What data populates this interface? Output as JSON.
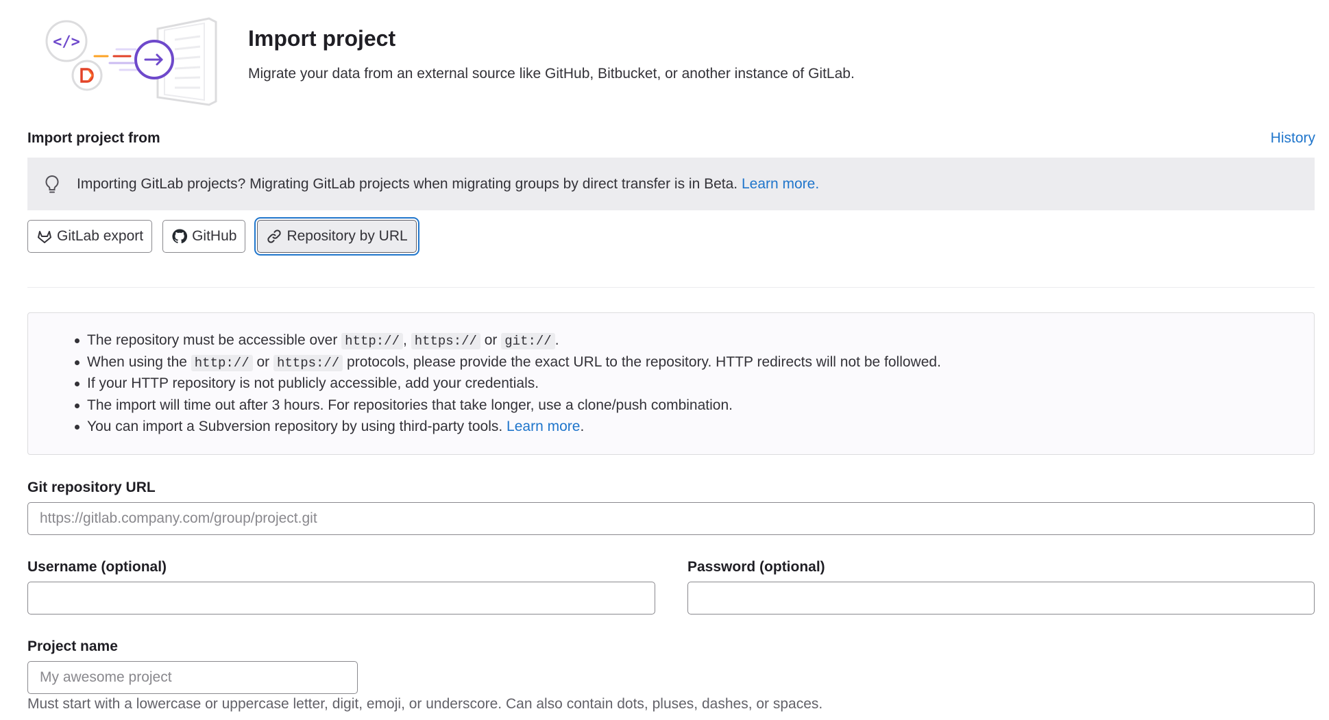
{
  "header": {
    "title": "Import project",
    "subtitle": "Migrate your data from an external source like GitHub, Bitbucket, or another instance of GitLab."
  },
  "import_from": {
    "label": "Import project from",
    "history_link": "History"
  },
  "beta_alert": {
    "icon": "lightbulb-icon",
    "text": "Importing GitLab projects? Migrating GitLab projects when migrating groups by direct transfer is in Beta.",
    "link": "Learn more."
  },
  "sources": [
    {
      "label": "GitLab export",
      "icon": "tanuki-icon",
      "selected": false
    },
    {
      "label": "GitHub",
      "icon": "github-icon",
      "selected": false
    },
    {
      "label": "Repository by URL",
      "icon": "link-icon",
      "selected": true
    }
  ],
  "info": {
    "line1": {
      "text": "The repository must be accessible over",
      "code1": "http://",
      "sep1": ",",
      "code2": "https://",
      "sep2": "or",
      "code3": "git://",
      "end": "."
    },
    "line2": {
      "text": "When using the",
      "code1": "http://",
      "sep1": "or",
      "code2": "https://",
      "rest": "protocols, please provide the exact URL to the repository. HTTP redirects will not be followed."
    },
    "line3": "If your HTTP repository is not publicly accessible, add your credentials.",
    "line4": "The import will time out after 3 hours. For repositories that take longer, use a clone/push combination.",
    "line5": {
      "text": "You can import a Subversion repository by using third-party tools.",
      "link": "Learn more",
      "end": "."
    }
  },
  "form": {
    "git_url": {
      "label": "Git repository URL",
      "placeholder": "https://gitlab.company.com/group/project.git",
      "value": ""
    },
    "username": {
      "label": "Username (optional)",
      "value": ""
    },
    "password": {
      "label": "Password (optional)",
      "value": ""
    },
    "project_name": {
      "label": "Project name",
      "placeholder": "My awesome project",
      "value": "",
      "help": "Must start with a lowercase or uppercase letter, digit, emoji, or underscore. Can also contain dots, pluses, dashes, or spaces."
    }
  },
  "colors": {
    "link": "#1f75cb",
    "accent_purple": "#6e49cb",
    "accent_orange": "#e24329"
  }
}
